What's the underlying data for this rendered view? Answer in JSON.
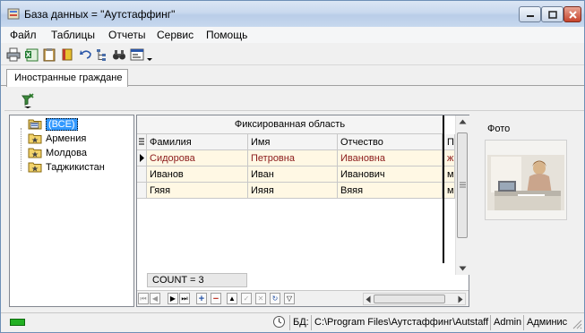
{
  "window": {
    "title": "База данных = \"Аутстаффинг\""
  },
  "menu": [
    "Файл",
    "Таблицы",
    "Отчеты",
    "Сервис",
    "Помощь"
  ],
  "toolbar": {
    "icons": [
      "printer-icon",
      "excel-icon",
      "clipboard-icon",
      "book-icon",
      "undo-icon",
      "tree-icon",
      "binoculars-icon",
      "form-icon"
    ]
  },
  "tabs": [
    {
      "label": "Иностранные граждане",
      "active": true
    }
  ],
  "tree": {
    "items": [
      {
        "label": "(ВСЕ)",
        "selected": true
      },
      {
        "label": "Армения",
        "selected": false
      },
      {
        "label": "Молдова",
        "selected": false
      },
      {
        "label": "Таджикистан",
        "selected": false
      }
    ]
  },
  "grid": {
    "fixed_area_label": "Фиксированная область",
    "columns": [
      "Фамилия",
      "Имя",
      "Отчество",
      "П"
    ],
    "rows": [
      {
        "last_name": "Сидорова",
        "first_name": "Петровна",
        "middle_name": "Ивановна",
        "extra": "ж",
        "current": true
      },
      {
        "last_name": "Иванов",
        "first_name": "Иван",
        "middle_name": "Иванович",
        "extra": "м",
        "current": false
      },
      {
        "last_name": "Гяяя",
        "first_name": "Ияяя",
        "middle_name": "Вяяя",
        "extra": "м",
        "current": false
      }
    ],
    "count_text": "COUNT = 3"
  },
  "photo": {
    "label": "Фото"
  },
  "status": {
    "db_label": "БД:",
    "db_path": "C:\\Program Files\\Аутстаффинг\\Autstaff",
    "user": "Admin",
    "role": "Админис"
  },
  "colors": {
    "current_row_text": "#8b1a1a",
    "row_bg": "#fff8e4",
    "selection": "#3399ff"
  }
}
